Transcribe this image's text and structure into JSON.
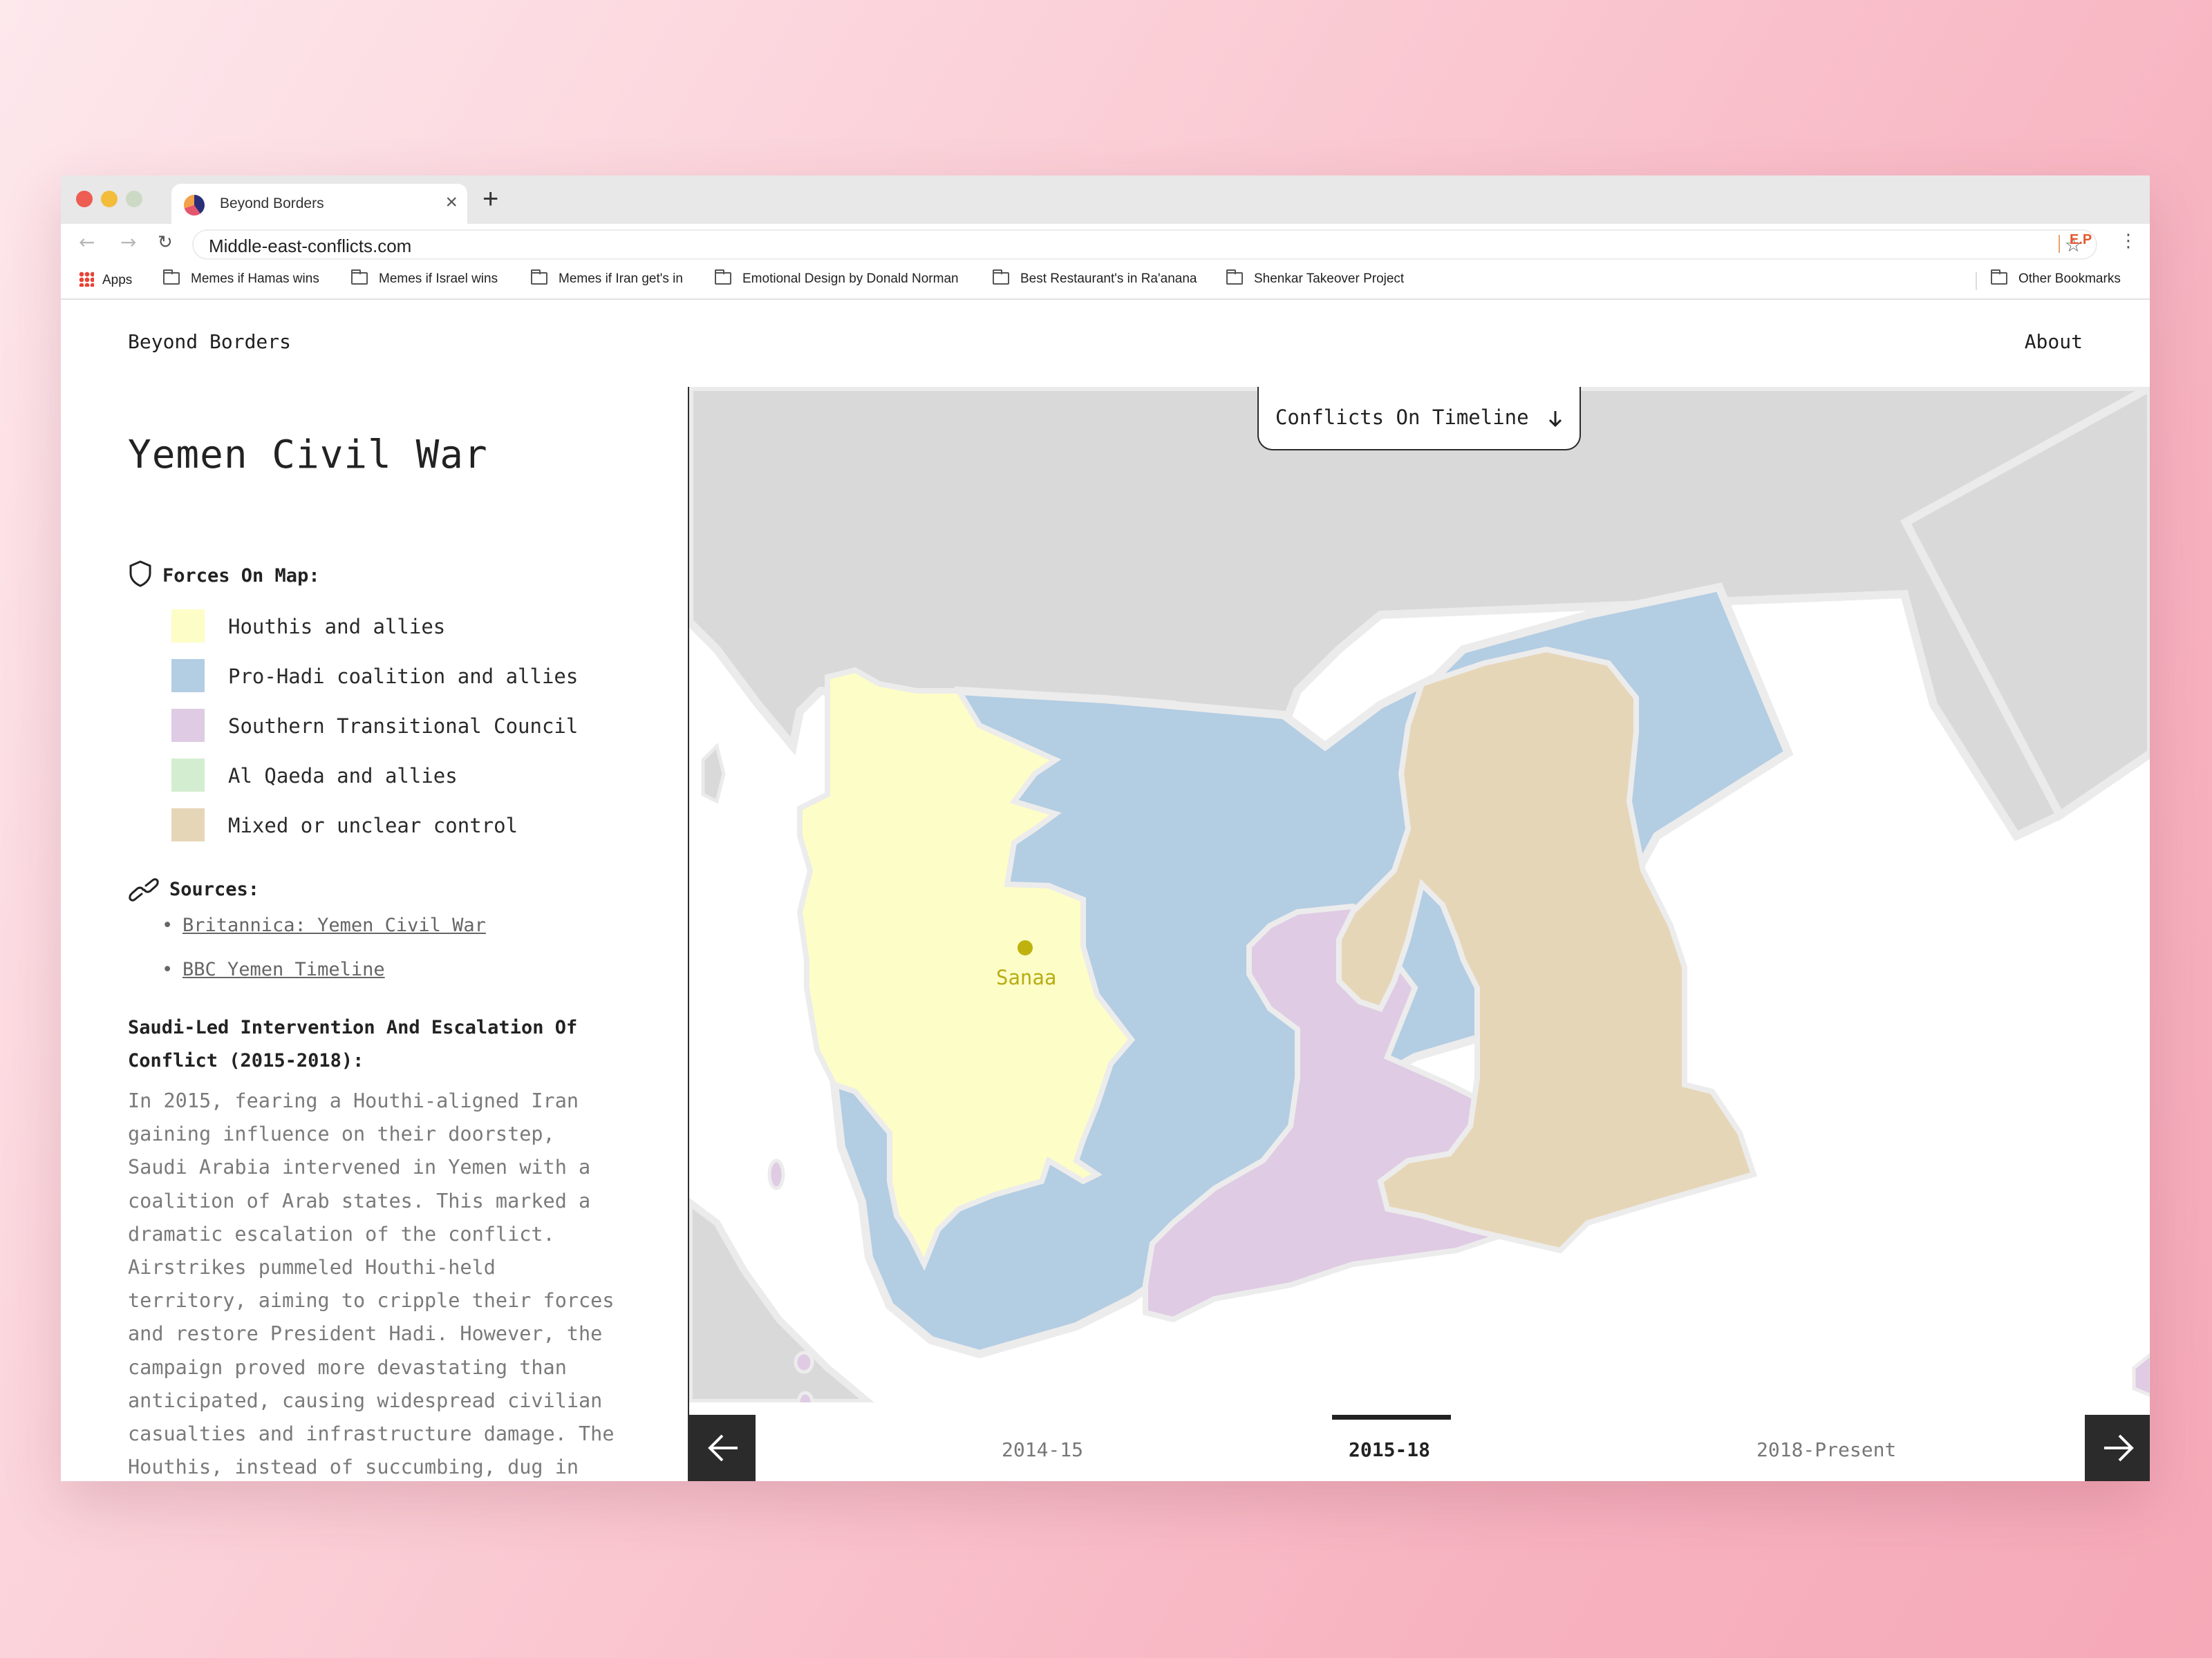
{
  "browser": {
    "tab_title": "Beyond Borders",
    "tab_close": "×",
    "new_tab": "+",
    "url": "Middle-east-conflicts.com",
    "profile_initials": "E.P",
    "bookmarks": [
      "Apps",
      "Memes if Hamas wins",
      "Memes if Israel wins",
      "Memes if Iran get's in",
      "Emotional Design by Donald Norman",
      "Best Restaurant's in Ra'anana",
      "Shenkar Takeover Project"
    ],
    "other_bookmarks": "Other Bookmarks"
  },
  "site": {
    "brand": "Beyond Borders",
    "about": "About"
  },
  "sidebar": {
    "title": "Yemen Civil War",
    "forces_heading": "Forces On Map:",
    "legend": [
      {
        "label": "Houthis and allies",
        "color": "#fdfdc7"
      },
      {
        "label": "Pro-Hadi coalition and allies",
        "color": "#b3cde3"
      },
      {
        "label": "Southern Transitional Council",
        "color": "#dfcbe4"
      },
      {
        "label": "Al Qaeda and allies",
        "color": "#d3edd0"
      },
      {
        "label": "Mixed or unclear control",
        "color": "#e6d6b8"
      }
    ],
    "sources_heading": "Sources:",
    "sources": [
      "Britannica: Yemen Civil War",
      "BBC Yemen Timeline"
    ],
    "section_heading": "Saudi-Led Intervention And Escalation Of Conflict (2015-2018):",
    "body": "In 2015, fearing a Houthi-aligned Iran gaining influence on their doorstep, Saudi Arabia intervened in Yemen with a coalition of Arab states. This marked a dramatic escalation of the conflict. Airstrikes pummeled Houthi-held territory, aiming to cripple their forces and restore President Hadi. However, the campaign proved more devastating than anticipated, causing widespread civilian casualties and infrastructure damage. The Houthis, instead of succumbing, dug in deeper, launching"
  },
  "map": {
    "timeline_button": "Conflicts On Timeline",
    "city": "Sanaa",
    "periods": [
      "2014-15",
      "2015-18",
      "2018-Present"
    ],
    "active_period": "2015-18"
  }
}
